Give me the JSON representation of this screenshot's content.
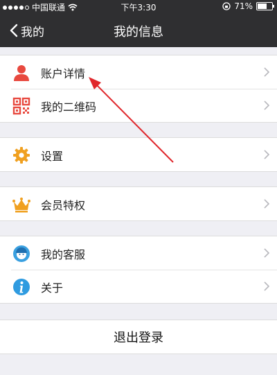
{
  "status_bar": {
    "carrier": "中国联通",
    "time": "下午3:30",
    "battery_text": "71%",
    "battery_level": 0.71
  },
  "nav": {
    "back_label": "我的",
    "title": "我的信息"
  },
  "groups": [
    {
      "items": [
        {
          "label": "账户详情",
          "icon": "person-icon"
        },
        {
          "label": "我的二维码",
          "icon": "qr-code-icon"
        }
      ]
    },
    {
      "items": [
        {
          "label": "设置",
          "icon": "gear-icon"
        }
      ]
    },
    {
      "items": [
        {
          "label": "会员特权",
          "icon": "crown-icon"
        }
      ]
    },
    {
      "items": [
        {
          "label": "我的客服",
          "icon": "customer-service-icon"
        },
        {
          "label": "关于",
          "icon": "info-icon"
        }
      ]
    }
  ],
  "logout_label": "退出登录",
  "annotation": {
    "color": "#e0262b",
    "target": "账户详情"
  },
  "colors": {
    "header_bg": "#2f2f31",
    "page_bg": "#efeff4",
    "person_icon": "#e8493f",
    "qr_icon": "#e8493f",
    "gear_icon": "#f0a020",
    "crown_icon": "#f0a020",
    "service_icon": "#3aa0e0",
    "info_icon": "#2f9be0"
  }
}
